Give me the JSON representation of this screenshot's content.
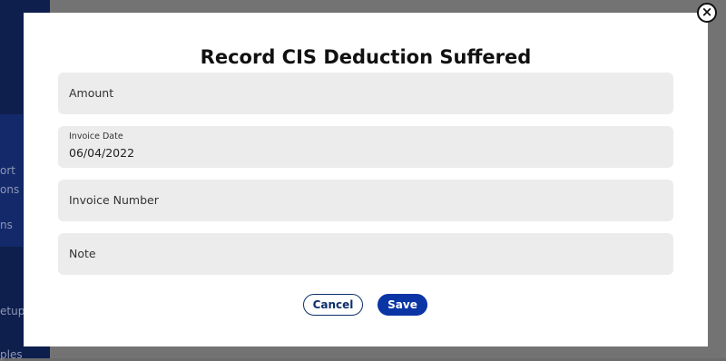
{
  "background": {
    "sidebar_fragments": [
      "ort",
      "ons",
      "ns",
      "etup",
      "ples"
    ]
  },
  "modal": {
    "title": "Record CIS Deduction Suffered",
    "fields": {
      "amount": {
        "placeholder": "Amount"
      },
      "invoice_date": {
        "label": "Invoice Date",
        "value": "06/04/2022"
      },
      "invoice_number": {
        "placeholder": "Invoice Number"
      },
      "note": {
        "placeholder": "Note"
      }
    },
    "buttons": {
      "cancel": "Cancel",
      "save": "Save"
    },
    "close_icon": "×"
  },
  "colors": {
    "primary": "#0b35a5",
    "sidebar": "#0e1f4d",
    "field_bg": "#ececec"
  }
}
